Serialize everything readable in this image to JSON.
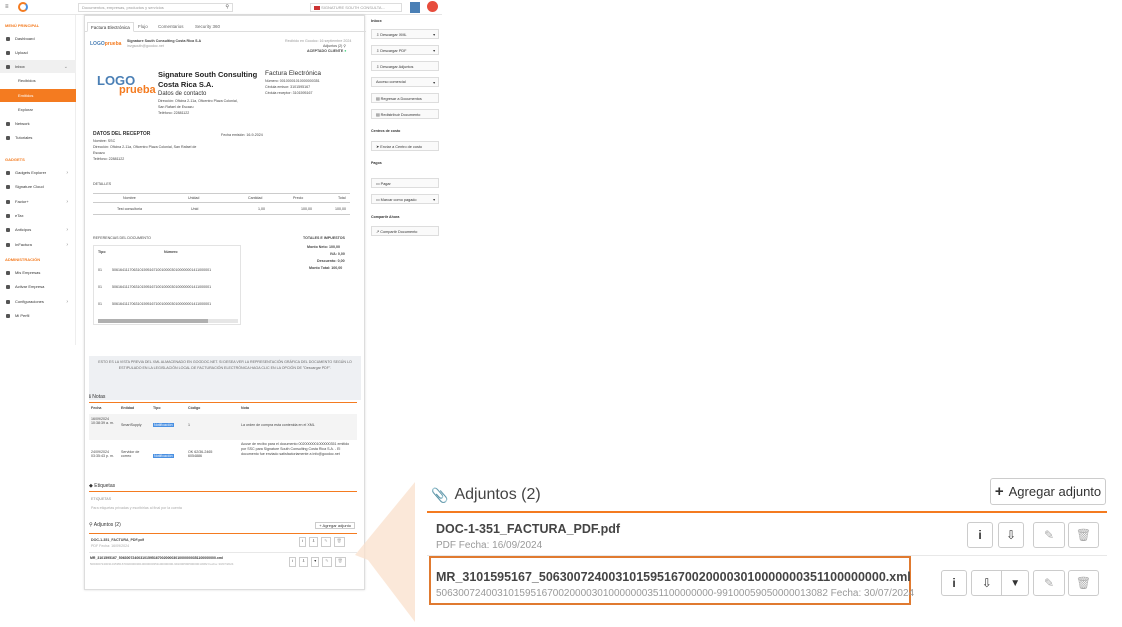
{
  "topbar": {
    "search_placeholder": "Documentos, empresas, productos y servicios",
    "company": "SIGNATURE SOUTH CONSULTA..."
  },
  "sidebar": {
    "section_main": "MENÚ PRINCIPAL",
    "items": [
      "Dashboard",
      "Upload",
      "Inbox",
      "Recibidos",
      "Emitidos",
      "Explorar",
      "Network",
      "Tutoriales"
    ],
    "section_gadgets": "GADGETS",
    "gadgets": [
      "Gadgets Explorer",
      "Signature Cloud",
      "Factor+",
      "eTax",
      "Anticipos",
      "InFactura"
    ],
    "section_admin": "ADMINISTRACIÓN",
    "admin": [
      "Mis Empresas",
      "Activar Empresa",
      "Configuraciones",
      "Mi Perfil"
    ]
  },
  "content": {
    "tabs": [
      "Factura Electrónica",
      "Flujo",
      "Comentarios",
      "Security 360"
    ],
    "company_small": "Signature South Consulting Costa Rica S.A",
    "email_small": "invgsouth@goodoc.net",
    "received": "Recibido en Goodoc: 16 septiembre 2024",
    "attachments_count": "Adjuntos (2)",
    "accepted": "ACEPTADO CLIENTE",
    "logo_a": "LOGO",
    "logo_b": "prueba",
    "company_name": "Signature South Consulting Costa Rica S.A.",
    "contact_title": "Datos de contacto",
    "contact_lines": [
      "Dirección: Oficina 2-11a, Oficentro Plaza Colonial,",
      "San Rafael de Escazu",
      "Teléfono: 22881122"
    ],
    "doc_type": "Factura Electrónica",
    "doc_lines": [
      "Número: 00100001010000000351",
      "Cédula emisor: 3101595167",
      "Cédula receptor: 3101595167"
    ],
    "receptor_title": "DATOS DEL RECEPTOR",
    "emission_date": "Fecha emisión: 16-9-2024",
    "receptor_lines": [
      "Nombre: SSC",
      "Dirección: Oficina 2-11a, Oficentro Plaza Colonial, San Rafael de",
      "Escazu",
      "Teléfono: 22881122"
    ],
    "details_title": "DETALLES",
    "details_headers": [
      "Nombre",
      "Unidad",
      "Cantidad",
      "Precio",
      "Total"
    ],
    "details_row": [
      "Test consultoria",
      "Unid",
      "1,00",
      "100,00",
      "100,00"
    ],
    "refs_title": "REFERENCIAS DEL DOCUMENTO",
    "refs_headers": [
      "Tipo",
      "Número"
    ],
    "refs_rows": [
      [
        "01",
        "50616411170631015951671001000030100000001411000001"
      ],
      [
        "01",
        "50616411170631015951671001000030100000001411000001"
      ],
      [
        "01",
        "50616411170631015951671001000030100000001411000001"
      ]
    ],
    "totals_title": "TOTALES E IMPUESTOS",
    "totals": [
      "Monto Neto: 100,00",
      "IVA: 0,00",
      "Descuento: 0,00",
      "Monto Total: 100,00"
    ],
    "notice": "ESTO ES LA VISTA PREVIA DEL XML ALMACENADO EN GOODOC.NET. SI DESEA VER LA REPRESENTACIÓN GRÁFICA DEL DOCUMENTO SEGÚN LO ESTIPULADO EN LA LEGISLACIÓN LOCAL DE FACTURACIÓN ELECTRÓNICA HAGA CLIC EN LA OPCIÓN DE \"Descargar PDF\".",
    "notes_title": "Notas",
    "notes_headers": [
      "Fecha",
      "Entidad",
      "Tipo",
      "Código",
      "Nota"
    ],
    "notes_rows": [
      [
        "16/09/2024 10:38:39 a. m.",
        "SmartSupply",
        "Notificación",
        "1",
        "La orden de compra esta contenida en el XML"
      ],
      [
        "24/09/2024 03:35:43 p. m.",
        "Servidor de correo",
        "Notificación",
        "OK 62/36-2465 6054886",
        "Acuse de recibo para el documento 0020000001000000351 emitido por SSC para Signature South Consulting Costa Rica S.A. - El documento fue enviado satisfactoriamente a info@goodoc.net"
      ]
    ],
    "tags_title": "Etiquetas",
    "tags_label": "ETIQUETAS",
    "tags_hint": "Para etiquetas privadas y escribirlas al final por la cuenta",
    "adj_title": "Adjuntos (2)",
    "adj_add": "Agregar adjunto"
  },
  "right": {
    "inbox": "Inbox",
    "buttons": [
      "Descargar XML",
      "Descargar PDF",
      "Descargar Adjuntos",
      "Acceso comercial",
      "Regresar a Documentos",
      "Redistribuir Documento"
    ],
    "centro_title": "Centros de costo",
    "centro_btn": "Enviar a Centro de costo",
    "pagos_title": "Pagos",
    "pagos_btns": [
      "Pagar",
      "Marcar como pagado"
    ],
    "compartir_title": "Compartir Ahora",
    "compartir_btn": "Compartir Documento"
  },
  "panel": {
    "title": "Adjuntos (2)",
    "add_button": "Agregar adjunto",
    "files": [
      {
        "name": "DOC-1-351_FACTURA_PDF.pdf",
        "meta": "PDF Fecha: 16/09/2024"
      },
      {
        "name": "MR_3101595167_50630072400310159516700200003010000000351100000000.xml",
        "meta": "50630072400310159516700200003010000000351100000000-99100059050000013082 Fecha: 30/07/2024"
      }
    ]
  },
  "colors": {
    "accent": "#f47b20",
    "highlight_border": "#e07a30"
  }
}
